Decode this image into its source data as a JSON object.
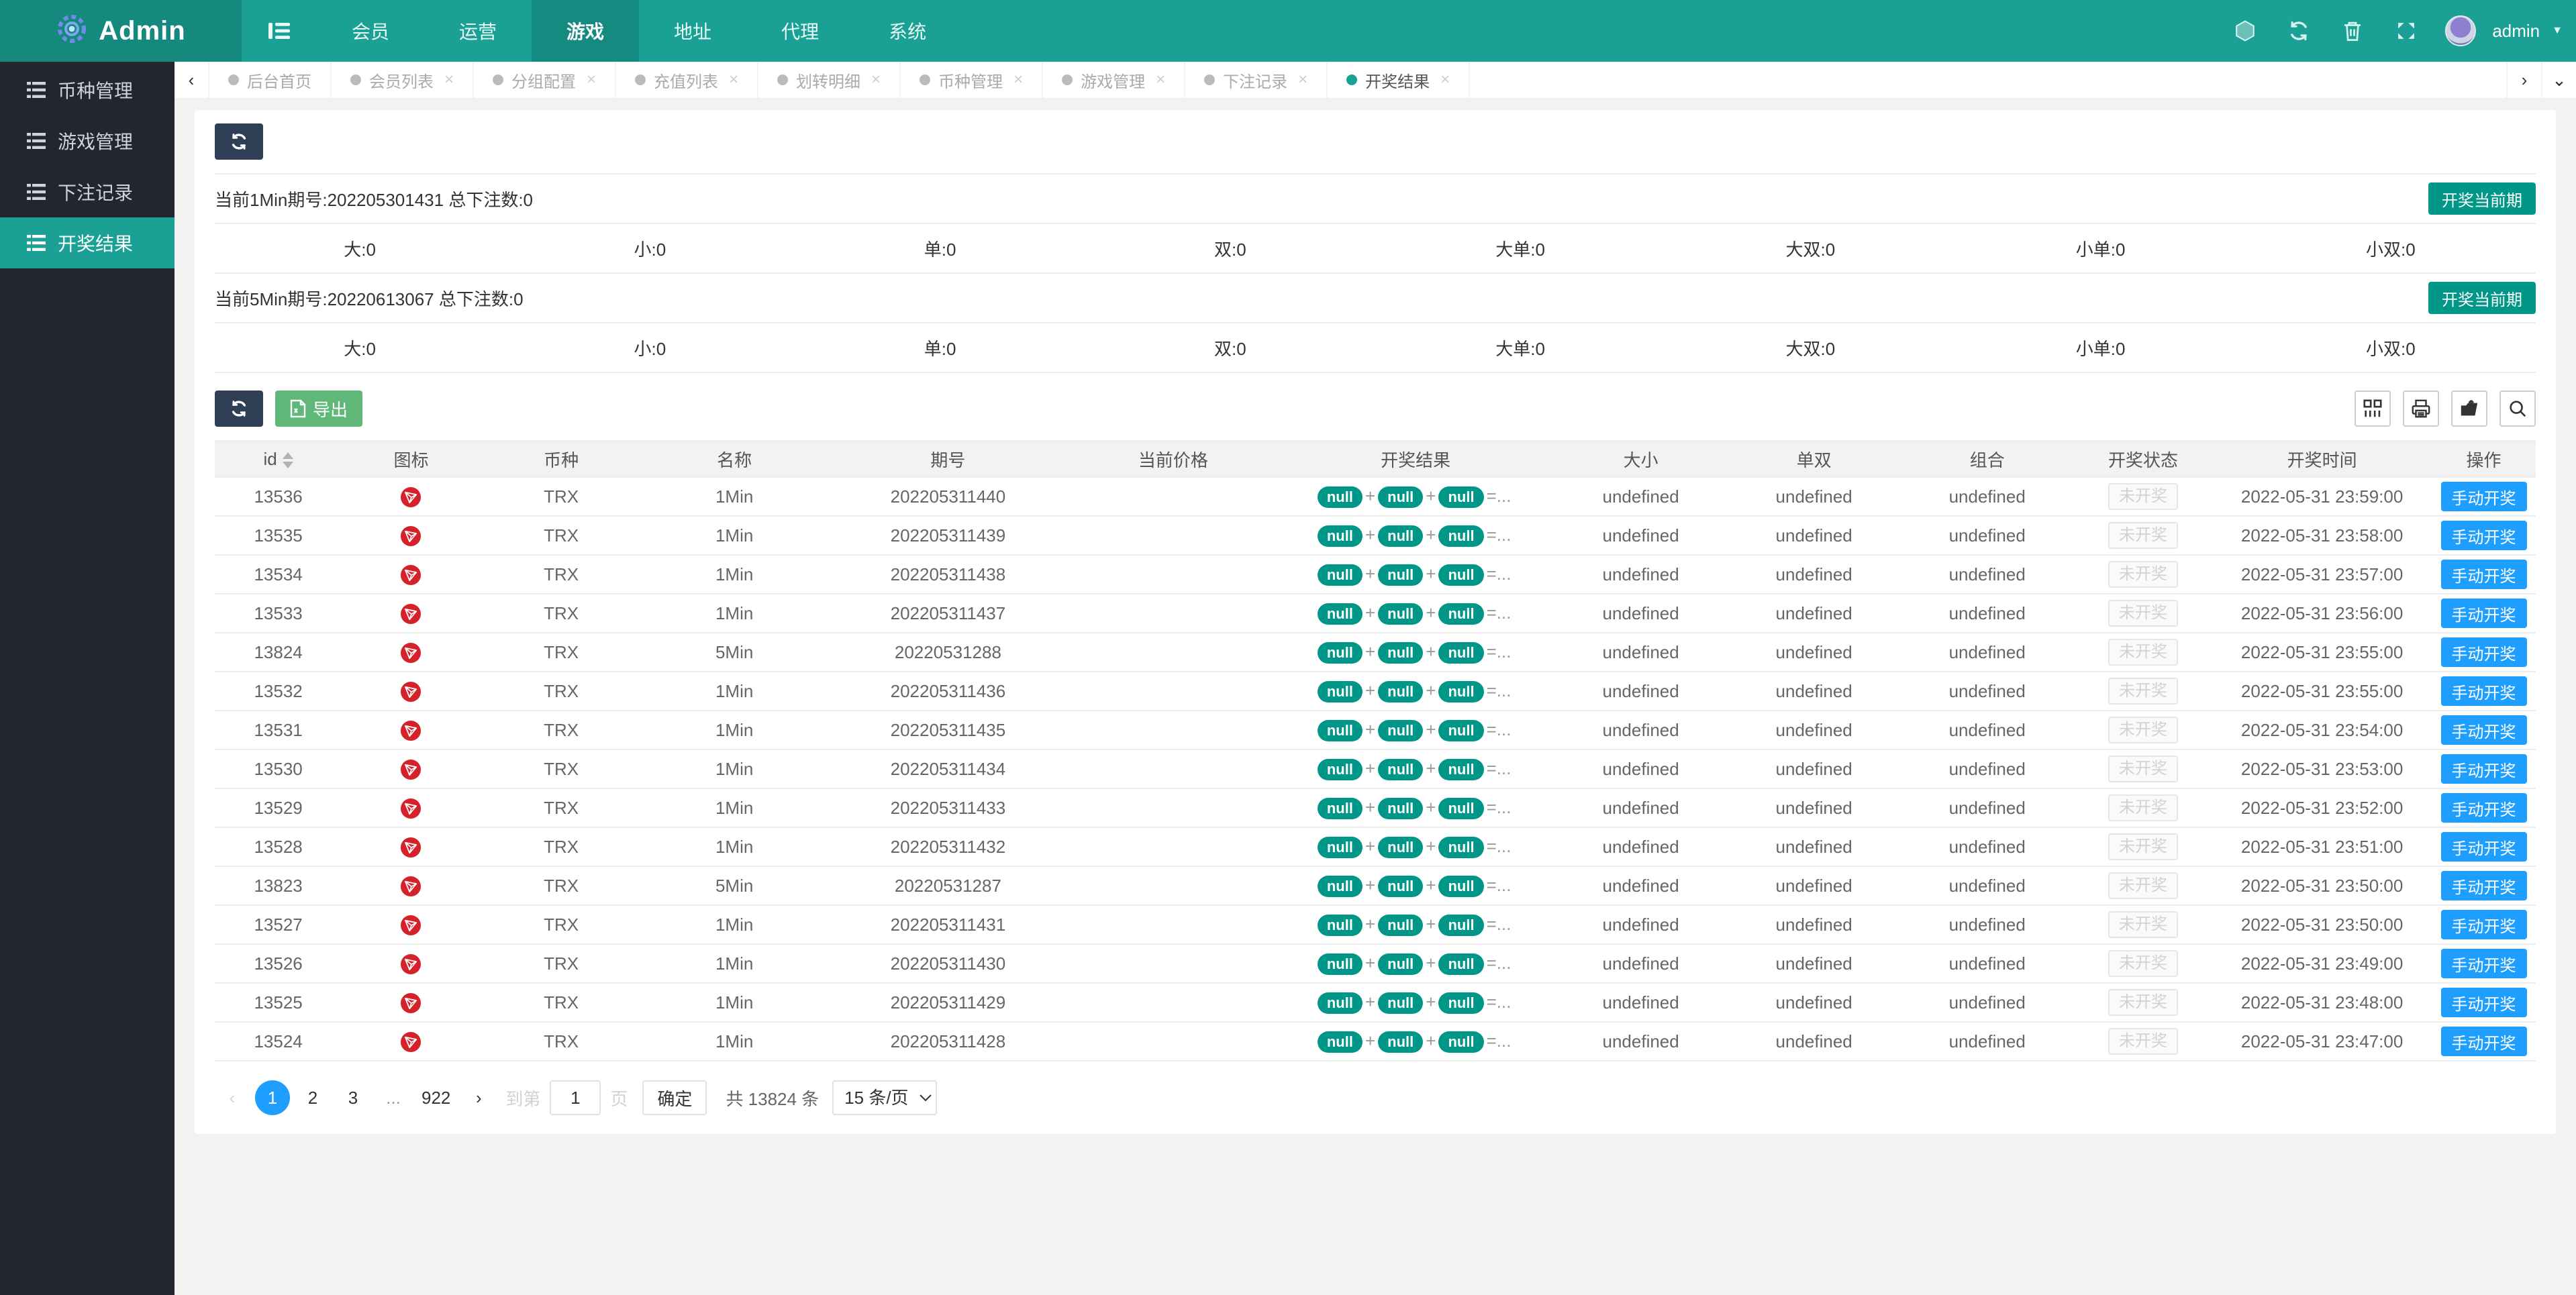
{
  "colors": {
    "accent": "#1aa094",
    "accent_dark": "#148a80",
    "sidebar_bg": "#23262e",
    "blue": "#1e9fff",
    "green": "#5fb878",
    "dark": "#2f4056",
    "teal_badge": "#009688",
    "tron_red": "#d4212a"
  },
  "navbar": {
    "brand": "Admin",
    "menu": [
      {
        "label": "会员"
      },
      {
        "label": "运营"
      },
      {
        "label": "游戏",
        "active": true
      },
      {
        "label": "地址"
      },
      {
        "label": "代理"
      },
      {
        "label": "系统"
      }
    ],
    "username": "admin",
    "caret": "▼"
  },
  "sidebar": {
    "items": [
      {
        "label": "币种管理"
      },
      {
        "label": "游戏管理"
      },
      {
        "label": "下注记录"
      },
      {
        "label": "开奖结果",
        "active": true
      }
    ]
  },
  "tabbar": {
    "left_arrow": "‹",
    "right_arrow": "›",
    "down_arrow": "⌄",
    "close_glyph": "×",
    "tabs": [
      {
        "label": "后台首页",
        "closable": false
      },
      {
        "label": "会员列表"
      },
      {
        "label": "分组配置"
      },
      {
        "label": "充值列表"
      },
      {
        "label": "划转明细"
      },
      {
        "label": "币种管理"
      },
      {
        "label": "游戏管理"
      },
      {
        "label": "下注记录"
      },
      {
        "label": "开奖结果",
        "active": true
      }
    ]
  },
  "panel": {
    "periods": [
      {
        "title": "当前1Min期号:202205301431 总下注数:0",
        "button": "开奖当前期",
        "stats": [
          "大:0",
          "小:0",
          "单:0",
          "双:0",
          "大单:0",
          "大双:0",
          "小单:0",
          "小双:0"
        ]
      },
      {
        "title": "当前5Min期号:20220613067 总下注数:0",
        "button": "开奖当前期",
        "stats": [
          "大:0",
          "小:0",
          "单:0",
          "双:0",
          "大单:0",
          "大双:0",
          "小单:0",
          "小双:0"
        ]
      }
    ]
  },
  "toolbar": {
    "export_label": "导出"
  },
  "table": {
    "headers": {
      "id": "id",
      "icon": "图标",
      "coin": "币种",
      "name": "名称",
      "period": "期号",
      "price": "当前价格",
      "result": "开奖结果",
      "big_small": "大小",
      "odd_even": "单双",
      "combo": "组合",
      "status": "开奖状态",
      "time": "开奖时间",
      "action": "操作"
    },
    "icon_name": "tron-icon",
    "result_separator": "+",
    "result_suffix": "=...",
    "rows": [
      {
        "id": "13536",
        "coin": "TRX",
        "name": "1Min",
        "period": "202205311440",
        "price": "",
        "result": [
          "null",
          "null",
          "null"
        ],
        "big_small": "undefined",
        "odd_even": "undefined",
        "combo": "undefined",
        "status": "未开奖",
        "time": "2022-05-31 23:59:00",
        "action": "手动开奖"
      },
      {
        "id": "13535",
        "coin": "TRX",
        "name": "1Min",
        "period": "202205311439",
        "price": "",
        "result": [
          "null",
          "null",
          "null"
        ],
        "big_small": "undefined",
        "odd_even": "undefined",
        "combo": "undefined",
        "status": "未开奖",
        "time": "2022-05-31 23:58:00",
        "action": "手动开奖"
      },
      {
        "id": "13534",
        "coin": "TRX",
        "name": "1Min",
        "period": "202205311438",
        "price": "",
        "result": [
          "null",
          "null",
          "null"
        ],
        "big_small": "undefined",
        "odd_even": "undefined",
        "combo": "undefined",
        "status": "未开奖",
        "time": "2022-05-31 23:57:00",
        "action": "手动开奖"
      },
      {
        "id": "13533",
        "coin": "TRX",
        "name": "1Min",
        "period": "202205311437",
        "price": "",
        "result": [
          "null",
          "null",
          "null"
        ],
        "big_small": "undefined",
        "odd_even": "undefined",
        "combo": "undefined",
        "status": "未开奖",
        "time": "2022-05-31 23:56:00",
        "action": "手动开奖"
      },
      {
        "id": "13824",
        "coin": "TRX",
        "name": "5Min",
        "period": "20220531288",
        "price": "",
        "result": [
          "null",
          "null",
          "null"
        ],
        "big_small": "undefined",
        "odd_even": "undefined",
        "combo": "undefined",
        "status": "未开奖",
        "time": "2022-05-31 23:55:00",
        "action": "手动开奖"
      },
      {
        "id": "13532",
        "coin": "TRX",
        "name": "1Min",
        "period": "202205311436",
        "price": "",
        "result": [
          "null",
          "null",
          "null"
        ],
        "big_small": "undefined",
        "odd_even": "undefined",
        "combo": "undefined",
        "status": "未开奖",
        "time": "2022-05-31 23:55:00",
        "action": "手动开奖"
      },
      {
        "id": "13531",
        "coin": "TRX",
        "name": "1Min",
        "period": "202205311435",
        "price": "",
        "result": [
          "null",
          "null",
          "null"
        ],
        "big_small": "undefined",
        "odd_even": "undefined",
        "combo": "undefined",
        "status": "未开奖",
        "time": "2022-05-31 23:54:00",
        "action": "手动开奖"
      },
      {
        "id": "13530",
        "coin": "TRX",
        "name": "1Min",
        "period": "202205311434",
        "price": "",
        "result": [
          "null",
          "null",
          "null"
        ],
        "big_small": "undefined",
        "odd_even": "undefined",
        "combo": "undefined",
        "status": "未开奖",
        "time": "2022-05-31 23:53:00",
        "action": "手动开奖"
      },
      {
        "id": "13529",
        "coin": "TRX",
        "name": "1Min",
        "period": "202205311433",
        "price": "",
        "result": [
          "null",
          "null",
          "null"
        ],
        "big_small": "undefined",
        "odd_even": "undefined",
        "combo": "undefined",
        "status": "未开奖",
        "time": "2022-05-31 23:52:00",
        "action": "手动开奖"
      },
      {
        "id": "13528",
        "coin": "TRX",
        "name": "1Min",
        "period": "202205311432",
        "price": "",
        "result": [
          "null",
          "null",
          "null"
        ],
        "big_small": "undefined",
        "odd_even": "undefined",
        "combo": "undefined",
        "status": "未开奖",
        "time": "2022-05-31 23:51:00",
        "action": "手动开奖"
      },
      {
        "id": "13823",
        "coin": "TRX",
        "name": "5Min",
        "period": "20220531287",
        "price": "",
        "result": [
          "null",
          "null",
          "null"
        ],
        "big_small": "undefined",
        "odd_even": "undefined",
        "combo": "undefined",
        "status": "未开奖",
        "time": "2022-05-31 23:50:00",
        "action": "手动开奖"
      },
      {
        "id": "13527",
        "coin": "TRX",
        "name": "1Min",
        "period": "202205311431",
        "price": "",
        "result": [
          "null",
          "null",
          "null"
        ],
        "big_small": "undefined",
        "odd_even": "undefined",
        "combo": "undefined",
        "status": "未开奖",
        "time": "2022-05-31 23:50:00",
        "action": "手动开奖"
      },
      {
        "id": "13526",
        "coin": "TRX",
        "name": "1Min",
        "period": "202205311430",
        "price": "",
        "result": [
          "null",
          "null",
          "null"
        ],
        "big_small": "undefined",
        "odd_even": "undefined",
        "combo": "undefined",
        "status": "未开奖",
        "time": "2022-05-31 23:49:00",
        "action": "手动开奖"
      },
      {
        "id": "13525",
        "coin": "TRX",
        "name": "1Min",
        "period": "202205311429",
        "price": "",
        "result": [
          "null",
          "null",
          "null"
        ],
        "big_small": "undefined",
        "odd_even": "undefined",
        "combo": "undefined",
        "status": "未开奖",
        "time": "2022-05-31 23:48:00",
        "action": "手动开奖"
      },
      {
        "id": "13524",
        "coin": "TRX",
        "name": "1Min",
        "period": "202205311428",
        "price": "",
        "result": [
          "null",
          "null",
          "null"
        ],
        "big_small": "undefined",
        "odd_even": "undefined",
        "combo": "undefined",
        "status": "未开奖",
        "time": "2022-05-31 23:47:00",
        "action": "手动开奖"
      }
    ]
  },
  "pagination": {
    "prev": "‹",
    "next": "›",
    "pages": [
      {
        "label": "1",
        "active": true
      },
      {
        "label": "2"
      },
      {
        "label": "3"
      },
      {
        "label": "...",
        "ellipsis": true
      },
      {
        "label": "922"
      }
    ],
    "goto_prefix": "到第",
    "goto_value": "1",
    "goto_suffix": "页",
    "confirm_label": "确定",
    "total_label": "共 13824 条",
    "page_size": "15 条/页"
  }
}
